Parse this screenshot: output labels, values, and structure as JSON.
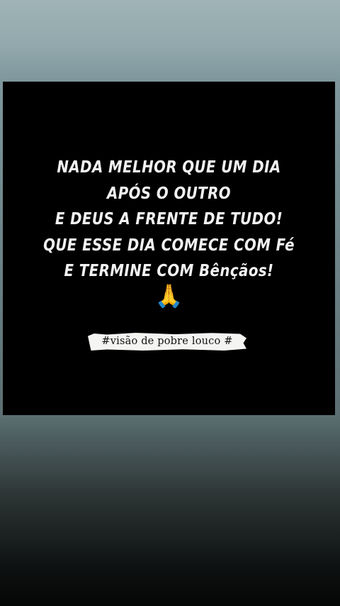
{
  "post": {
    "quote_lines": [
      "NADA MELHOR QUE UM DIA",
      "APÓS O OUTRO",
      "E DEUS A FRENTE DE TUDO!",
      "QUE ESSE DIA COMECE COM Fé",
      "E TERMINE COM Bênçãos!"
    ],
    "emoji": "🙏",
    "emoji_name": "praying-hands-icon",
    "hashtag": "#visão de pobre louco #"
  },
  "colors": {
    "card_background": "#000000",
    "text": "#f2f2f2",
    "tag_background": "#f4f4f2",
    "emoji": "#f0a928"
  }
}
